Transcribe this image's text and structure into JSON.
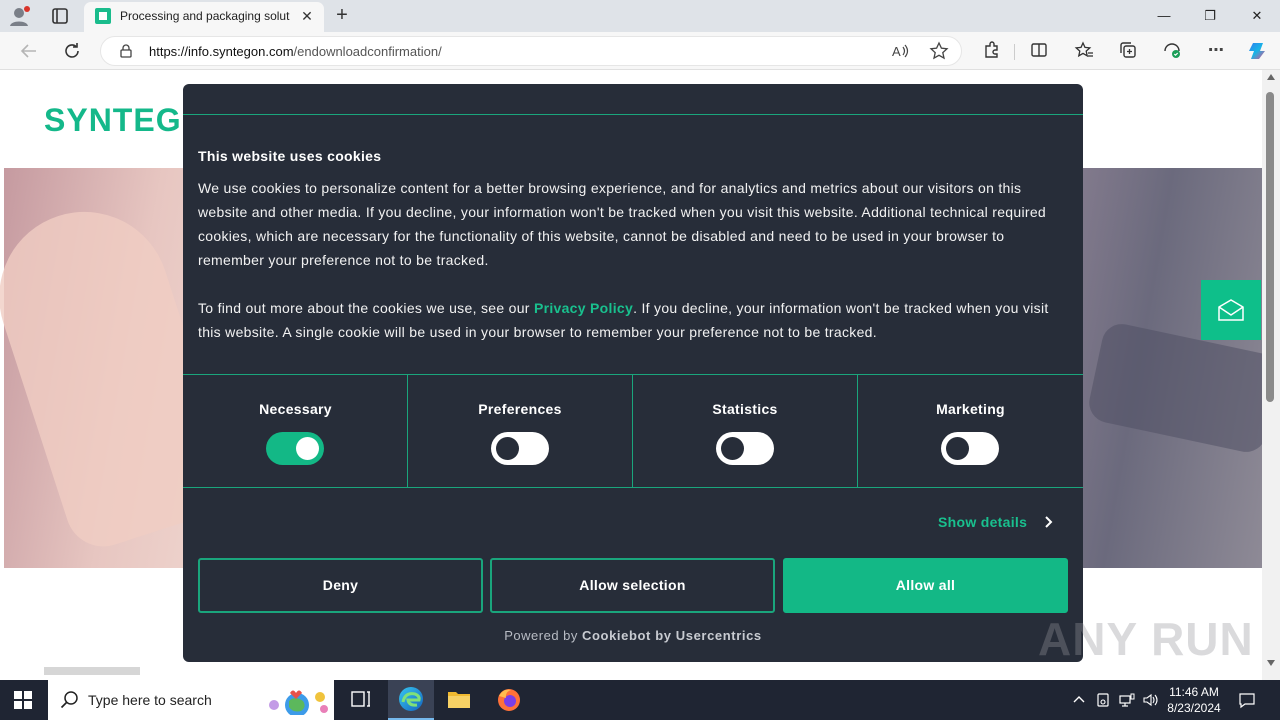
{
  "browser": {
    "tab_title": "Processing and packaging soluti",
    "url_domain": "https://info.syntegon.com",
    "url_path": "/endownloadconfirmation/",
    "minimize": "—",
    "maximize": "❐",
    "close": "✕",
    "new_tab": "+"
  },
  "page": {
    "logo_text": "SYNTEG",
    "accent_color": "#13b886"
  },
  "cookie_dialog": {
    "title": "This website uses cookies",
    "paragraph1": "We use cookies to personalize content for a better browsing experience, and for analytics and metrics about our visitors on this website and other media. If you decline, your information won't be tracked when you visit this website. Additional technical required cookies, which are necessary for the functionality of this website, cannot be disabled and need to be used in your browser to remember your preference not to be tracked.",
    "paragraph2_before": "To find out more about the cookies we use, see our ",
    "privacy_link": "Privacy Policy",
    "paragraph2_after": ". If you decline, your information won't be tracked when you visit this website. A single cookie will be used in your browser to remember your preference not to be tracked.",
    "toggles": [
      {
        "label": "Necessary",
        "enabled": true
      },
      {
        "label": "Preferences",
        "enabled": false
      },
      {
        "label": "Statistics",
        "enabled": false
      },
      {
        "label": "Marketing",
        "enabled": false
      }
    ],
    "show_details": "Show details",
    "buttons": {
      "deny": "Deny",
      "allow_selection": "Allow selection",
      "allow_all": "Allow all"
    },
    "powered_prefix": "Powered by",
    "powered_brand": "Cookiebot by Usercentrics"
  },
  "watermark": "ANY RUN",
  "taskbar": {
    "search_placeholder": "Type here to search",
    "time": "11:46 AM",
    "date": "8/23/2024"
  }
}
